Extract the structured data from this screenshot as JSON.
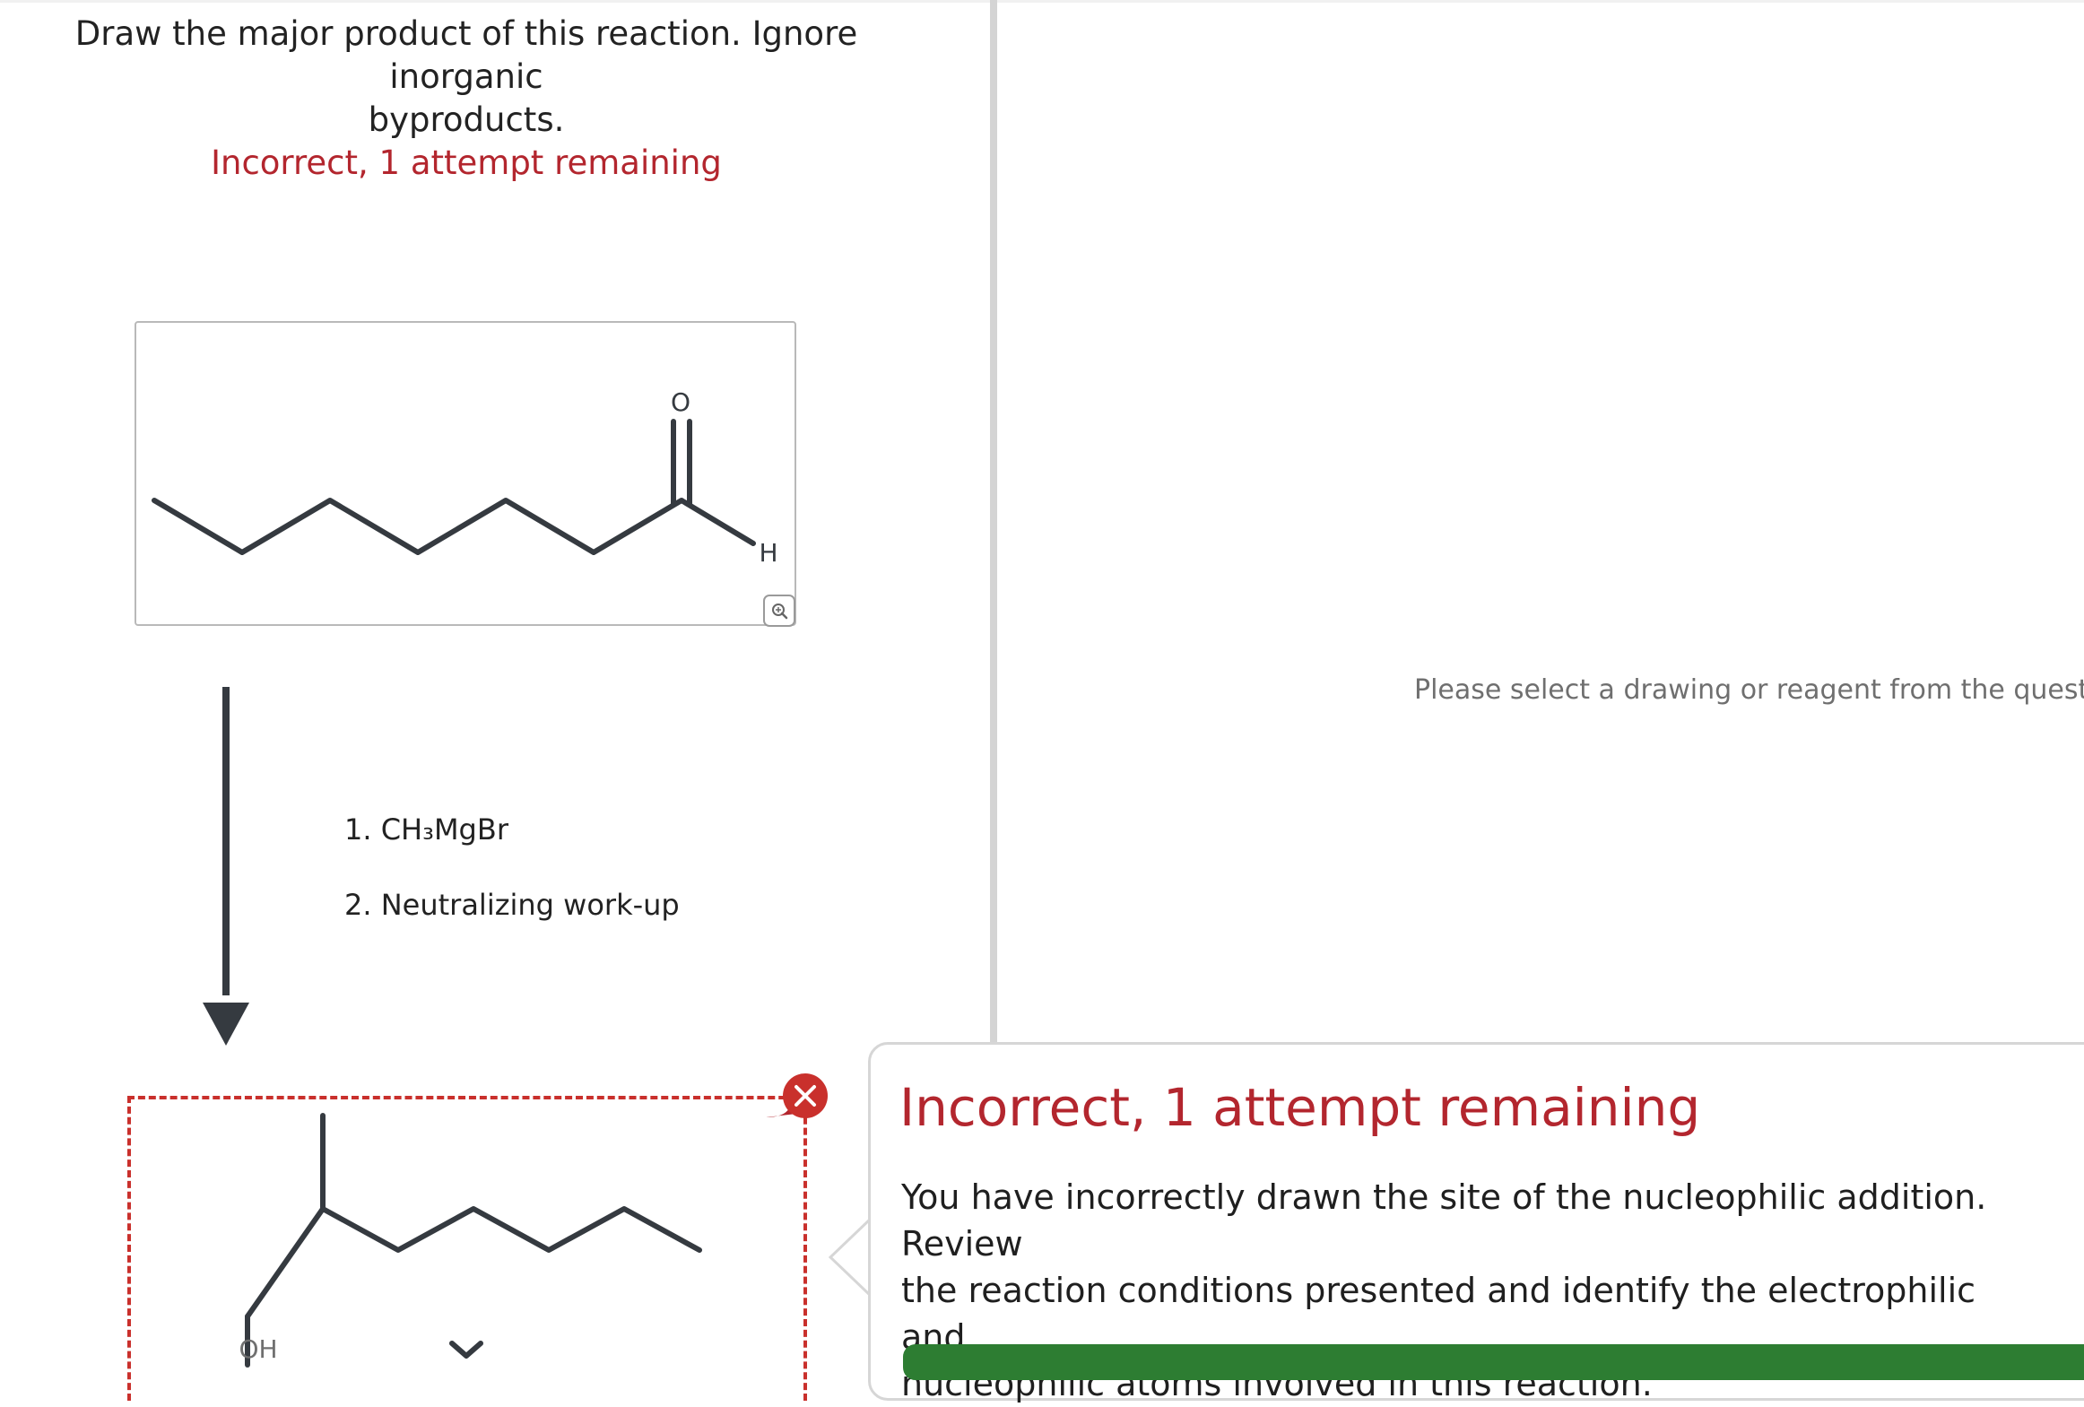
{
  "question": {
    "prompt_line1": "Draw the major product of this reaction. Ignore inorganic",
    "prompt_line2": "byproducts.",
    "status": "Incorrect, 1 attempt remaining"
  },
  "reactant": {
    "atom_o": "O",
    "atom_h": "H",
    "zoom_icon": "zoom-in-icon"
  },
  "reagents": {
    "step1": "1. CH₃MgBr",
    "step2": "2. Neutralizing work-up"
  },
  "answer": {
    "atom_oh": "OH",
    "remove_icon": "close-icon"
  },
  "right_panel": {
    "placeholder": "Please select a drawing or reagent from the questio"
  },
  "feedback": {
    "title": "Incorrect, 1 attempt remaining",
    "line1": "You have incorrectly drawn the site of the nucleophilic addition. Review",
    "line2": "the reaction conditions presented and identify the electrophilic and",
    "line3": "nucleophilic atoms involved in this reaction."
  },
  "colors": {
    "error": "#b3262e",
    "bond": "#353a40",
    "success_bar": "#2d7d32"
  }
}
